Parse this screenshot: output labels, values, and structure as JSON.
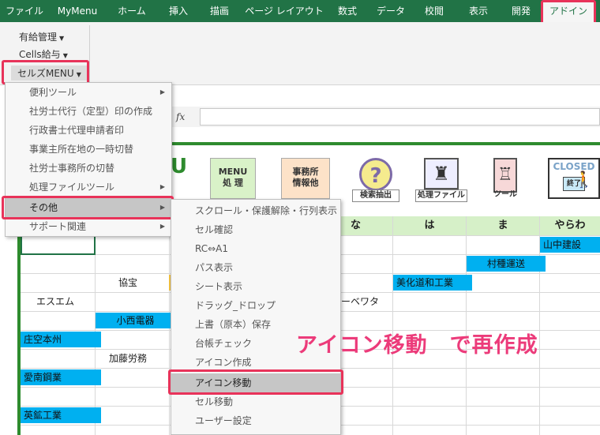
{
  "tabs": [
    {
      "id": "file",
      "label": "ファイル"
    },
    {
      "id": "mymenu",
      "label": "MyMenu"
    },
    {
      "id": "home",
      "label": "ホーム"
    },
    {
      "id": "insert",
      "label": "挿入"
    },
    {
      "id": "draw",
      "label": "描画"
    },
    {
      "id": "layout",
      "label": "ページ レイアウト"
    },
    {
      "id": "formula",
      "label": "数式"
    },
    {
      "id": "data",
      "label": "データ"
    },
    {
      "id": "review",
      "label": "校閲"
    },
    {
      "id": "view",
      "label": "表示"
    },
    {
      "id": "dev",
      "label": "開発"
    },
    {
      "id": "addin",
      "label": "アドイン"
    }
  ],
  "ribbon": {
    "yukyu": "有給管理",
    "cells_kyuyo": "Cells給与",
    "cells_menu": "セルズMENU"
  },
  "formula_bar": {
    "fx": "fx"
  },
  "menu1": {
    "items": [
      {
        "label": "便利ツール",
        "arrow": true
      },
      {
        "label": "社労士代行（定型）印の作成",
        "arrow": false
      },
      {
        "label": "行政書士代理申請者印",
        "arrow": false
      },
      {
        "label": "事業主所在地の一時切替",
        "arrow": false
      },
      {
        "label": "社労士事務所の切替",
        "arrow": false
      },
      {
        "label": "処理ファイルツール",
        "arrow": true
      },
      {
        "label": "その他",
        "arrow": true
      },
      {
        "label": "サポート関連",
        "arrow": true
      }
    ]
  },
  "menu2": {
    "items": [
      "スクロール・保護解除・行列表示",
      "セル確認",
      "RC⇔A1",
      "パス表示",
      "シート表示",
      "ドラッグ_ドロップ",
      "上書（原本）保存",
      "台帳チェック",
      "アイコン作成",
      "アイコン移動",
      "セル移動",
      "ユーザー設定"
    ]
  },
  "sheet": {
    "letter_u": "U",
    "buttons": {
      "menu": {
        "l1": "MENU",
        "l2": "処 理"
      },
      "jimusho": {
        "l1": "事務所",
        "l2": "情報他"
      },
      "search": "検索抽出",
      "file": "処理ファイル",
      "tool": "ツール",
      "closed": {
        "l1": "CLOSED",
        "l2": "終了"
      }
    },
    "headers": [
      "な",
      "は",
      "ま",
      "やらわ"
    ],
    "cells": {
      "yamanaka": "山中建設",
      "murata": "村種運送",
      "bika": "美化道和工業",
      "kyoho": "協宝",
      "esuemu": "エスエム",
      "bewata": "ーベワタ",
      "konishi": "小西電器",
      "shoku": "庄空本州",
      "kato": "加藤労務",
      "aichi": "愛南鋼業",
      "eiko": "英鉱工業"
    }
  },
  "annotation": "アイコン移動　で再作成",
  "colors": {
    "excel_green": "#217346",
    "highlight": "#e8335a",
    "annotation": "#ec3b7a",
    "cell_blue": "#00b0f0"
  }
}
